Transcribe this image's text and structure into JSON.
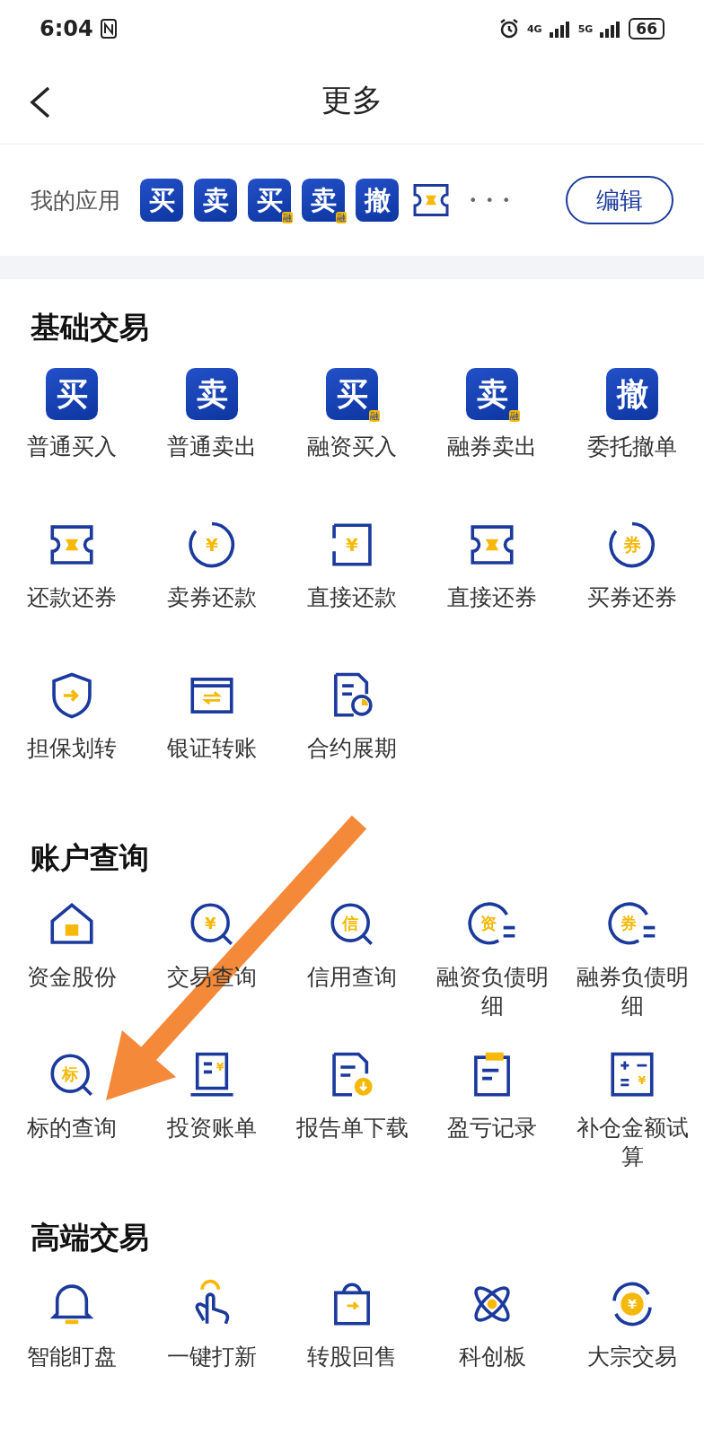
{
  "status_bar": {
    "time": "6:04",
    "network_1": "4G",
    "network_2": "5G",
    "battery": "66"
  },
  "header": {
    "title": "更多"
  },
  "my_apps": {
    "label": "我的应用",
    "apps": [
      {
        "kind": "tile",
        "glyph": "买"
      },
      {
        "kind": "tile",
        "glyph": "卖"
      },
      {
        "kind": "tile",
        "glyph": "买",
        "badge": "融"
      },
      {
        "kind": "tile",
        "glyph": "卖",
        "badge": "融"
      },
      {
        "kind": "tile",
        "glyph": "撤"
      },
      {
        "kind": "ticket"
      }
    ],
    "more": "• • •",
    "edit_button": "编辑"
  },
  "sections": [
    {
      "title": "基础交易",
      "items": [
        {
          "label": "普通买入",
          "icon": {
            "kind": "tile",
            "glyph": "买"
          }
        },
        {
          "label": "普通卖出",
          "icon": {
            "kind": "tile",
            "glyph": "卖"
          }
        },
        {
          "label": "融资买入",
          "icon": {
            "kind": "tile",
            "glyph": "买",
            "badge": "融"
          }
        },
        {
          "label": "融券卖出",
          "icon": {
            "kind": "tile",
            "glyph": "卖",
            "badge": "融"
          }
        },
        {
          "label": "委托撤单",
          "icon": {
            "kind": "tile",
            "glyph": "撤"
          }
        },
        {
          "label": "还款还券",
          "icon": {
            "kind": "ticket"
          }
        },
        {
          "label": "卖券还款",
          "icon": {
            "kind": "coin",
            "glyph": "¥"
          }
        },
        {
          "label": "直接还款",
          "icon": {
            "kind": "frame",
            "glyph": "¥"
          }
        },
        {
          "label": "直接还券",
          "icon": {
            "kind": "ticket"
          }
        },
        {
          "label": "买券还券",
          "icon": {
            "kind": "coin",
            "glyph": "券"
          }
        },
        {
          "label": "担保划转",
          "icon": {
            "kind": "shield"
          }
        },
        {
          "label": "银证转账",
          "icon": {
            "kind": "card"
          }
        },
        {
          "label": "合约展期",
          "icon": {
            "kind": "doc-clock"
          }
        }
      ]
    },
    {
      "title": "账户查询",
      "items": [
        {
          "label": "资金股份",
          "icon": {
            "kind": "house"
          }
        },
        {
          "label": "交易查询",
          "icon": {
            "kind": "search",
            "glyph": "¥"
          }
        },
        {
          "label": "信用查询",
          "icon": {
            "kind": "search",
            "glyph": "信"
          }
        },
        {
          "label": "融资负债明细",
          "icon": {
            "kind": "list-coin",
            "glyph": "资"
          }
        },
        {
          "label": "融券负债明细",
          "icon": {
            "kind": "list-coin",
            "glyph": "券"
          }
        },
        {
          "label": "标的查询",
          "icon": {
            "kind": "search",
            "glyph": "标"
          }
        },
        {
          "label": "投资账单",
          "icon": {
            "kind": "bill",
            "glyph": "¥"
          }
        },
        {
          "label": "报告单下载",
          "icon": {
            "kind": "doc-download"
          }
        },
        {
          "label": "盈亏记录",
          "icon": {
            "kind": "clipboard"
          }
        },
        {
          "label": "补仓金额试算",
          "icon": {
            "kind": "calculator",
            "glyph": "¥"
          }
        }
      ]
    },
    {
      "title": "高端交易",
      "items": [
        {
          "label": "智能盯盘",
          "icon": {
            "kind": "bell"
          }
        },
        {
          "label": "一键打新",
          "icon": {
            "kind": "hand"
          }
        },
        {
          "label": "转股回售",
          "icon": {
            "kind": "bag"
          }
        },
        {
          "label": "科创板",
          "icon": {
            "kind": "atom"
          }
        },
        {
          "label": "大宗交易",
          "icon": {
            "kind": "cycle",
            "glyph": "¥"
          }
        }
      ]
    }
  ]
}
